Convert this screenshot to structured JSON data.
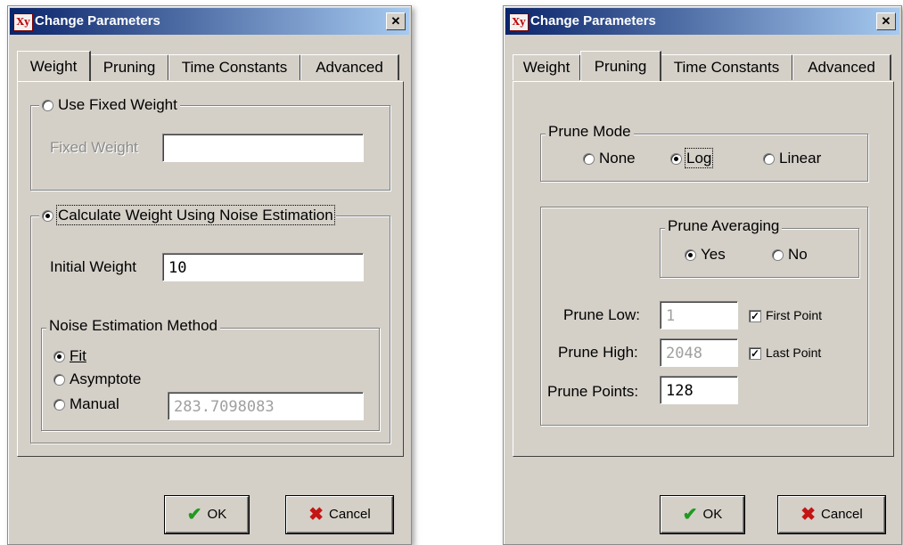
{
  "left_dialog": {
    "title": "Change Parameters",
    "close_icon": "close-icon",
    "tabs": [
      "Weight",
      "Pruning",
      "Time Constants",
      "Advanced"
    ],
    "active_tab": "Weight",
    "fixed_weight_group": {
      "legend": "Use Fixed Weight",
      "selected": false
    },
    "fixed_weight_label": "Fixed Weight",
    "fixed_weight_value": "",
    "calc_group": {
      "legend": "Calculate Weight Using Noise Estimation",
      "selected": true
    },
    "initial_weight_label": "Initial Weight",
    "initial_weight_value": "10",
    "noise_group": {
      "legend": "Noise Estimation Method"
    },
    "methods": [
      {
        "label": "Fit",
        "selected": true
      },
      {
        "label": "Asymptote",
        "selected": false
      },
      {
        "label": "Manual",
        "selected": false
      }
    ],
    "manual_value": "283.7098083",
    "ok_label": "OK",
    "cancel_label": "Cancel"
  },
  "right_dialog": {
    "title": "Change Parameters",
    "close_icon": "close-icon",
    "tabs": [
      "Weight",
      "Pruning",
      "Time Constants",
      "Advanced"
    ],
    "active_tab": "Pruning",
    "prune_mode": {
      "legend": "Prune Mode",
      "options": [
        {
          "label": "None",
          "selected": false
        },
        {
          "label": "Log",
          "selected": true
        },
        {
          "label": "Linear",
          "selected": false
        }
      ]
    },
    "prune_averaging": {
      "legend": "Prune Averaging",
      "options": [
        {
          "label": "Yes",
          "selected": true
        },
        {
          "label": "No",
          "selected": false
        }
      ]
    },
    "prune_low_label": "Prune Low:",
    "prune_low_value": "1",
    "first_point_label": "First Point",
    "first_point_checked": true,
    "prune_high_label": "Prune High:",
    "prune_high_value": "2048",
    "last_point_label": "Last Point",
    "last_point_checked": true,
    "prune_points_label": "Prune Points:",
    "prune_points_value": "128",
    "ok_label": "OK",
    "cancel_label": "Cancel"
  },
  "colors": {
    "dialog_bg": "#d4d0c8",
    "title_start": "#0a246a",
    "title_end": "#a6caf0",
    "ok_check": "#1f9a1f",
    "cancel_x": "#c41414"
  },
  "icons": {
    "app": "app-icon",
    "ok": "checkmark-icon",
    "cancel": "x-icon"
  }
}
